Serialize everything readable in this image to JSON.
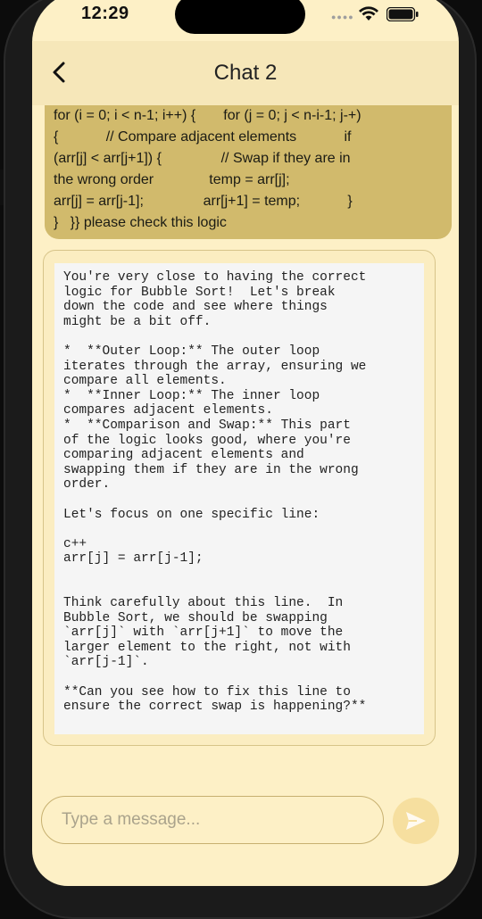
{
  "status_bar": {
    "time": "12:29",
    "icons": [
      "signal-dots-icon",
      "wifi-icon",
      "battery-icon"
    ]
  },
  "header": {
    "title": "Chat 2",
    "back_icon": "chevron-left-icon"
  },
  "messages": [
    {
      "role": "user",
      "text": "for (i = 0; i < n-1; i++) {       for (j = 0; j < n-i-1; j-+)\n{            // Compare adjacent elements            if\n(arr[j] < arr[j+1]) {               // Swap if they are in\nthe wrong order              temp = arr[j];\narr[j] = arr[j-1];               arr[j+1] = temp;            }\n}   }} please check this logic"
    },
    {
      "role": "assistant",
      "text": "You're very close to having the correct\nlogic for Bubble Sort!  Let's break\ndown the code and see where things\nmight be a bit off.\n\n*  **Outer Loop:** The outer loop\niterates through the array, ensuring we\ncompare all elements.\n*  **Inner Loop:** The inner loop\ncompares adjacent elements.\n*  **Comparison and Swap:** This part\nof the logic looks good, where you're\ncomparing adjacent elements and\nswapping them if they are in the wrong\norder.\n\nLet's focus on one specific line:\n\nc++\narr[j] = arr[j-1];\n\n\nThink carefully about this line.  In\nBubble Sort, we should be swapping\n`arr[j]` with `arr[j+1]` to move the\nlarger element to the right, not with\n`arr[j-1]`.\n\n**Can you see how to fix this line to\nensure the correct swap is happening?**"
    }
  ],
  "composer": {
    "placeholder": "Type a message...",
    "value": "",
    "send_icon": "send-icon"
  },
  "colors": {
    "background": "#fdf0c6",
    "header": "#f6e7b9",
    "user_bubble": "#d1ba6c",
    "assistant_card": "#fbedc1",
    "code_block": "#f5f5f5",
    "send_button": "#f6df9f"
  }
}
